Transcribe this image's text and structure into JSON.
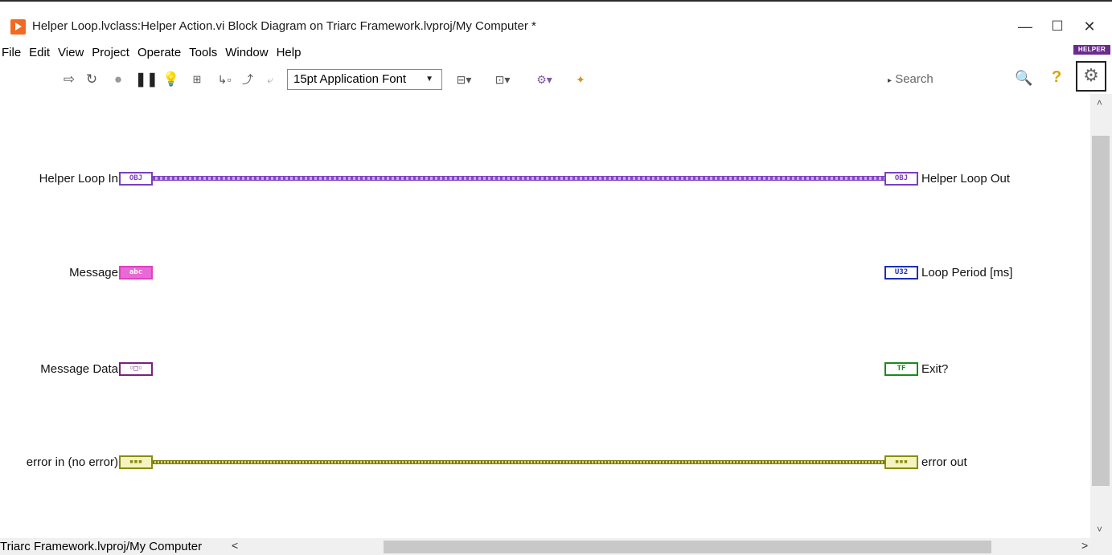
{
  "window": {
    "title": "Helper Loop.lvclass:Helper Action.vi Block Diagram on Triarc Framework.lvproj/My Computer *",
    "minimize": "—",
    "maximize": "☐",
    "close": "✕"
  },
  "menu": {
    "items": [
      "File",
      "Edit",
      "View",
      "Project",
      "Operate",
      "Tools",
      "Window",
      "Help"
    ]
  },
  "badge": {
    "text": "HELPER",
    "icon": "gear-icon"
  },
  "toolbar": {
    "font_select": "15pt Application Font",
    "search_placeholder": "Search",
    "icons": [
      "run-arrow-icon",
      "run-continuously-icon",
      "abort-icon",
      "pause-icon",
      "highlight-execution-icon",
      "retain-wire-values-icon",
      "step-into-icon",
      "step-over-icon",
      "step-out-icon",
      "align-objects-icon",
      "distribute-objects-icon",
      "reorder-icon",
      "clean-up-diagram-icon"
    ]
  },
  "diagram": {
    "inputs": [
      {
        "label": "Helper Loop In",
        "terminal": "OBJ",
        "type": "object"
      },
      {
        "label": "Message",
        "terminal": "abc",
        "type": "string"
      },
      {
        "label": "Message Data",
        "terminal": "◦□◦",
        "type": "variant"
      },
      {
        "label": "error in (no error)",
        "terminal": "▪▪▪",
        "type": "error-cluster"
      }
    ],
    "outputs": [
      {
        "label": "Helper Loop Out",
        "terminal": "OBJ",
        "type": "object"
      },
      {
        "label": "Loop Period [ms]",
        "terminal": "U32",
        "type": "u32"
      },
      {
        "label": "Exit?",
        "terminal": "TF",
        "type": "boolean"
      },
      {
        "label": "error out",
        "terminal": "▪▪▪",
        "type": "error-cluster"
      }
    ]
  },
  "status": {
    "context": "Triarc Framework.lvproj/My Computer"
  }
}
